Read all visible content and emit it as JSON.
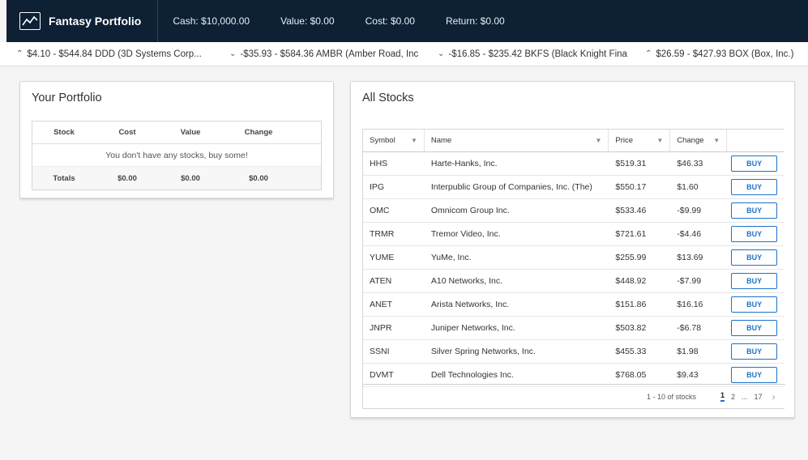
{
  "header": {
    "title": "Fantasy Portfolio",
    "icon": "line-chart-icon",
    "cash": "Cash: $10,000.00",
    "value": "Value: $0.00",
    "cost": "Cost: $0.00",
    "return": "Return: $0.00"
  },
  "ticker": [
    {
      "direction": "up",
      "text": "$4.10 - $544.84 DDD (3D Systems Corp..."
    },
    {
      "direction": "down",
      "text": "-$35.93 - $584.36 AMBR (Amber Road, Inc"
    },
    {
      "direction": "down",
      "text": "-$16.85 - $235.42 BKFS (Black Knight Fina"
    },
    {
      "direction": "up",
      "text": "$26.59 - $427.93 BOX (Box, Inc.)"
    }
  ],
  "portfolio": {
    "title": "Your Portfolio",
    "columns": [
      "Stock",
      "Cost",
      "Value",
      "Change"
    ],
    "empty_message": "You don't have any stocks, buy some!",
    "totals": {
      "label": "Totals",
      "cost": "$0.00",
      "value": "$0.00",
      "change": "$0.00"
    }
  },
  "stocks": {
    "title": "All Stocks",
    "columns": {
      "symbol": "Symbol",
      "name": "Name",
      "price": "Price",
      "change": "Change"
    },
    "buy_label": "BUY",
    "rows": [
      {
        "symbol": "HHS",
        "name": "Harte-Hanks, Inc.",
        "price": "$519.31",
        "change": "$46.33"
      },
      {
        "symbol": "IPG",
        "name": "Interpublic Group of Companies, Inc. (The)",
        "price": "$550.17",
        "change": "$1.60"
      },
      {
        "symbol": "OMC",
        "name": "Omnicom Group Inc.",
        "price": "$533.46",
        "change": "-$9.99"
      },
      {
        "symbol": "TRMR",
        "name": "Tremor Video, Inc.",
        "price": "$721.61",
        "change": "-$4.46"
      },
      {
        "symbol": "YUME",
        "name": "YuMe, Inc.",
        "price": "$255.99",
        "change": "$13.69"
      },
      {
        "symbol": "ATEN",
        "name": "A10 Networks, Inc.",
        "price": "$448.92",
        "change": "-$7.99"
      },
      {
        "symbol": "ANET",
        "name": "Arista Networks, Inc.",
        "price": "$151.86",
        "change": "$16.16"
      },
      {
        "symbol": "JNPR",
        "name": "Juniper Networks, Inc.",
        "price": "$503.82",
        "change": "-$6.78"
      },
      {
        "symbol": "SSNI",
        "name": "Silver Spring Networks, Inc.",
        "price": "$455.33",
        "change": "$1.98"
      },
      {
        "symbol": "DVMT",
        "name": "Dell Technologies Inc.",
        "price": "$768.05",
        "change": "$9.43"
      }
    ],
    "pagination": {
      "range": "1 - 10 of stocks",
      "pages": [
        "1",
        "2",
        "...",
        "17"
      ],
      "current": "1"
    }
  }
}
